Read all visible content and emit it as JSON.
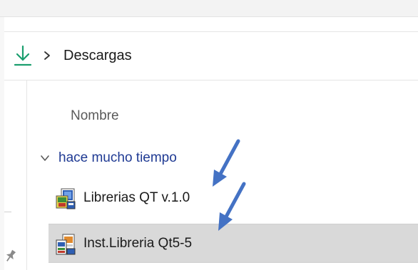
{
  "breadcrumb": {
    "folder_icon": "download-icon",
    "separator_icon": "chevron-right-icon",
    "label": "Descargas"
  },
  "file_list": {
    "column_header": "Nombre",
    "group": {
      "label": "hace mucho tiempo",
      "expand_icon": "chevron-down-icon"
    },
    "items": [
      {
        "name": "Librerias QT v.1.0",
        "icon": "installer-icon",
        "selected": false
      },
      {
        "name": "Inst.Libreria Qt5-5",
        "icon": "installer-icon",
        "selected": true
      }
    ]
  },
  "navigation_pane": {
    "pin_icon": "pin-icon"
  },
  "colors": {
    "accent_download": "#1a9e6e",
    "group_label": "#1f3a93",
    "selection": "#d9d9d9",
    "annotation_arrow": "#4472c4"
  }
}
